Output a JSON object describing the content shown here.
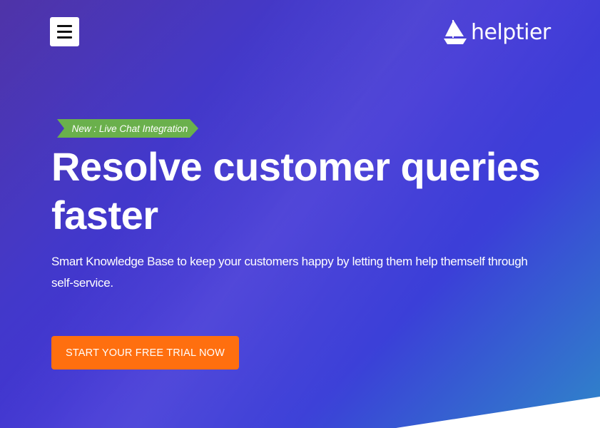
{
  "header": {
    "logo_text": "helptier",
    "menu_icon": "hamburger-menu-icon",
    "logo_icon": "sailboat-icon"
  },
  "hero": {
    "badge": "New : Live Chat Integration",
    "headline": "Resolve customer queries faster",
    "subtext": "Smart Knowledge Base to keep your customers happy by letting them help themself through self-service.",
    "cta_label": "START YOUR FREE TRIAL NOW"
  },
  "colors": {
    "badge": "#6ab04c",
    "cta": "#ff6f0f",
    "background_start": "#3b1d9e",
    "background_end": "#2f86c9"
  }
}
